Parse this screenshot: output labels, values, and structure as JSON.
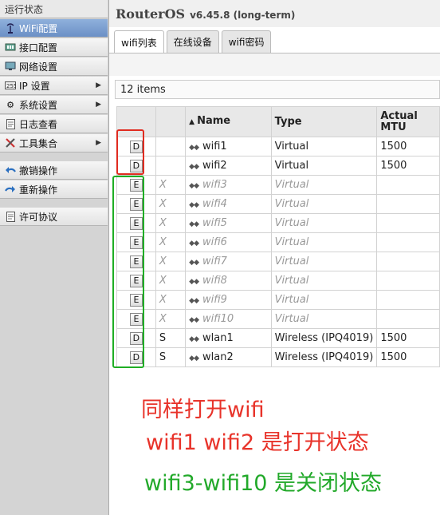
{
  "sidebar": {
    "items": [
      {
        "label": "运行状态",
        "icon": "",
        "kind": "header"
      },
      {
        "label": "WiFi配置",
        "icon": "wifi-antenna-icon",
        "kind": "active"
      },
      {
        "label": "接口配置",
        "icon": "network-card-icon"
      },
      {
        "label": "网络设置",
        "icon": "network-icon"
      },
      {
        "label": "IP 设置",
        "icon": "ip-icon",
        "arrow": "▶"
      },
      {
        "label": "系统设置",
        "icon": "gear-icon",
        "arrow": "▶"
      },
      {
        "label": "日志查看",
        "icon": "document-icon"
      },
      {
        "label": "工具集合",
        "icon": "tools-icon",
        "arrow": "▶"
      },
      {
        "label": "撤销操作",
        "icon": "undo-arrow-icon"
      },
      {
        "label": "重新操作",
        "icon": "redo-arrow-icon"
      },
      {
        "label": "许可协议",
        "icon": "license-document-icon"
      }
    ]
  },
  "header": {
    "title": "RouterOS",
    "version": "v6.45.8 (long-term)"
  },
  "tabs": [
    {
      "label": "wifi列表",
      "active": true
    },
    {
      "label": "在线设备"
    },
    {
      "label": "wifi密码"
    }
  ],
  "item_count": "12 items",
  "table": {
    "headers": {
      "sort_icon": "▲",
      "name": "Name",
      "type": "Type",
      "mtu": "Actual MTU"
    },
    "rows": [
      {
        "button": "D",
        "flag": "",
        "name": "wifi1",
        "type": "Virtual",
        "mtu": "1500",
        "disabled": false
      },
      {
        "button": "D",
        "flag": "",
        "name": "wifi2",
        "type": "Virtual",
        "mtu": "1500",
        "disabled": false
      },
      {
        "button": "E",
        "flag": "X",
        "name": "wifi3",
        "type": "Virtual",
        "mtu": "",
        "disabled": true
      },
      {
        "button": "E",
        "flag": "X",
        "name": "wifi4",
        "type": "Virtual",
        "mtu": "",
        "disabled": true
      },
      {
        "button": "E",
        "flag": "X",
        "name": "wifi5",
        "type": "Virtual",
        "mtu": "",
        "disabled": true
      },
      {
        "button": "E",
        "flag": "X",
        "name": "wifi6",
        "type": "Virtual",
        "mtu": "",
        "disabled": true
      },
      {
        "button": "E",
        "flag": "X",
        "name": "wifi7",
        "type": "Virtual",
        "mtu": "",
        "disabled": true
      },
      {
        "button": "E",
        "flag": "X",
        "name": "wifi8",
        "type": "Virtual",
        "mtu": "",
        "disabled": true
      },
      {
        "button": "E",
        "flag": "X",
        "name": "wifi9",
        "type": "Virtual",
        "mtu": "",
        "disabled": true
      },
      {
        "button": "E",
        "flag": "X",
        "name": "wifi10",
        "type": "Virtual",
        "mtu": "",
        "disabled": true
      },
      {
        "button": "D",
        "flag": "S",
        "name": "wlan1",
        "type": "Wireless (IPQ4019)",
        "mtu": "1500",
        "disabled": false
      },
      {
        "button": "D",
        "flag": "S",
        "name": "wlan2",
        "type": "Wireless (IPQ4019)",
        "mtu": "1500",
        "disabled": false
      }
    ]
  },
  "annotations": {
    "line1": "同样打开wifi",
    "line2": "wifi1 wifi2 是打开状态",
    "line3": "wifi3-wifi10 是关闭状态",
    "red": "#e8332a",
    "green": "#22a92a"
  }
}
